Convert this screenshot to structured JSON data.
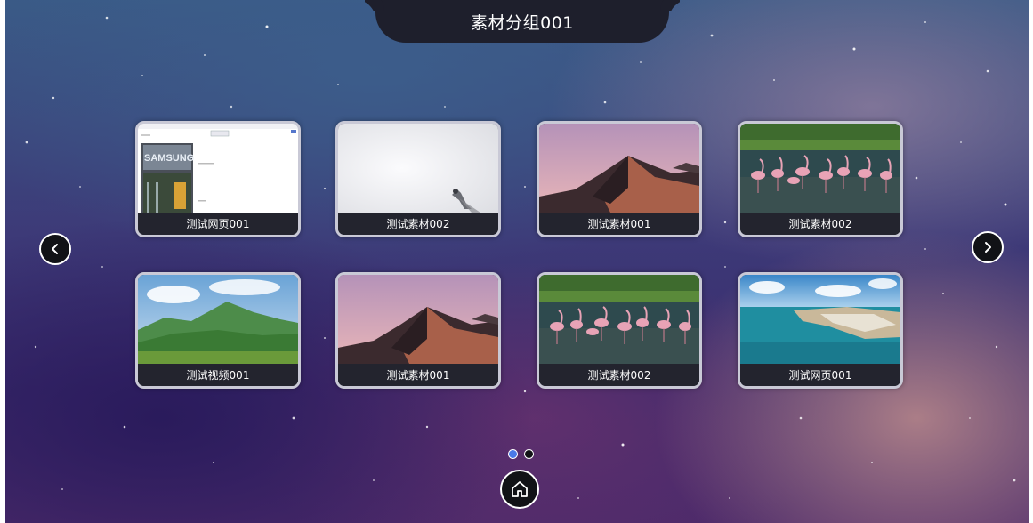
{
  "header": {
    "title": "素材分组001"
  },
  "cards": [
    {
      "caption": "测试网页001",
      "thumbnail": "webpage-screenshot"
    },
    {
      "caption": "测试素材002",
      "thumbnail": "white-snow-scene"
    },
    {
      "caption": "测试素材001",
      "thumbnail": "desert-dune"
    },
    {
      "caption": "测试素材002",
      "thumbnail": "flamingos"
    },
    {
      "caption": "测试视频001",
      "thumbnail": "green-mountains"
    },
    {
      "caption": "测试素材001",
      "thumbnail": "desert-dune"
    },
    {
      "caption": "测试素材002",
      "thumbnail": "flamingos"
    },
    {
      "caption": "测试网页001",
      "thumbnail": "coastal-city-aerial"
    }
  ],
  "pagination": {
    "total_pages": 2,
    "current_page": 1
  },
  "navigation": {
    "prev_icon": "chevron-left-icon",
    "next_icon": "chevron-right-icon",
    "home_icon": "home-icon"
  },
  "colors": {
    "active_dot": "#4a7ae8",
    "inactive_dot": "#111216"
  }
}
